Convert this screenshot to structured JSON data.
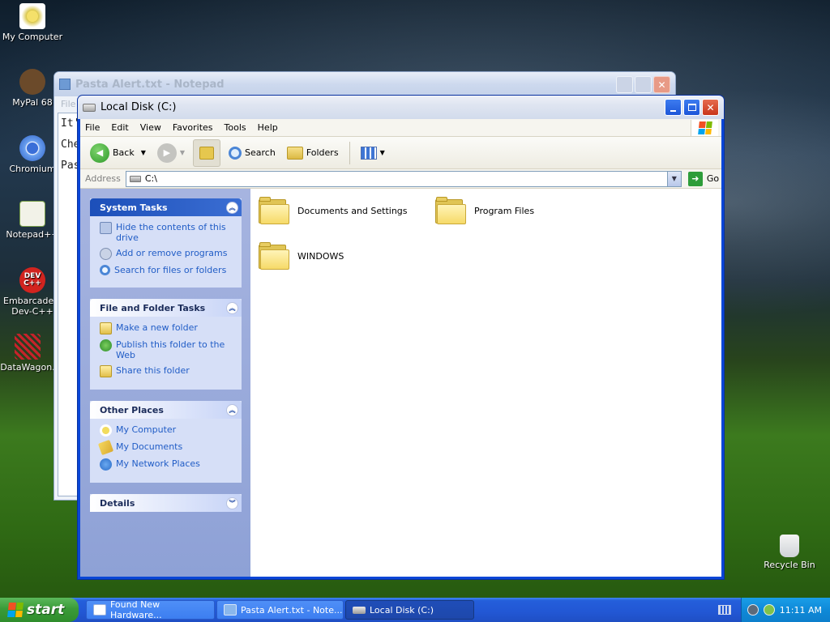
{
  "desktop": {
    "icons": [
      {
        "label": "My Computer"
      },
      {
        "label": "MyPal 68"
      },
      {
        "label": "Chromium"
      },
      {
        "label": "Notepad++"
      },
      {
        "label": "Embarcadero Dev-C++"
      },
      {
        "label": "DataWagon."
      },
      {
        "label": "Recycle Bin"
      }
    ],
    "devcpp_glyph": "DEV C++"
  },
  "notepad": {
    "title": "Pasta Alert.txt - Notepad",
    "menu_first": "File",
    "lines": [
      "It'",
      "Che",
      "Pas"
    ]
  },
  "explorer": {
    "title": "Local Disk (C:)",
    "menu": [
      "File",
      "Edit",
      "View",
      "Favorites",
      "Tools",
      "Help"
    ],
    "toolbar": {
      "back": "Back",
      "search": "Search",
      "folders": "Folders"
    },
    "address": {
      "label": "Address",
      "value": "C:\\",
      "go": "Go"
    },
    "system_tasks": {
      "title": "System Tasks",
      "items": [
        "Hide the contents of this drive",
        "Add or remove programs",
        "Search for files or folders"
      ]
    },
    "file_folder_tasks": {
      "title": "File and Folder Tasks",
      "items": [
        "Make a new folder",
        "Publish this folder to the Web",
        "Share this folder"
      ]
    },
    "other_places": {
      "title": "Other Places",
      "items": [
        "My Computer",
        "My Documents",
        "My Network Places"
      ]
    },
    "details": {
      "title": "Details"
    },
    "folders": [
      "Documents and Settings",
      "Program Files",
      "WINDOWS"
    ]
  },
  "taskbar": {
    "start": "start",
    "tasks": [
      "Found New Hardware...",
      "Pasta Alert.txt - Note...",
      "Local Disk (C:)"
    ],
    "clock": "11:11 AM"
  },
  "colors": {
    "link_blue": "#215dc6",
    "task_pane_bg": "#d6dff7",
    "taskbar_blue": "#245edb",
    "start_green": "#3a9b38"
  }
}
